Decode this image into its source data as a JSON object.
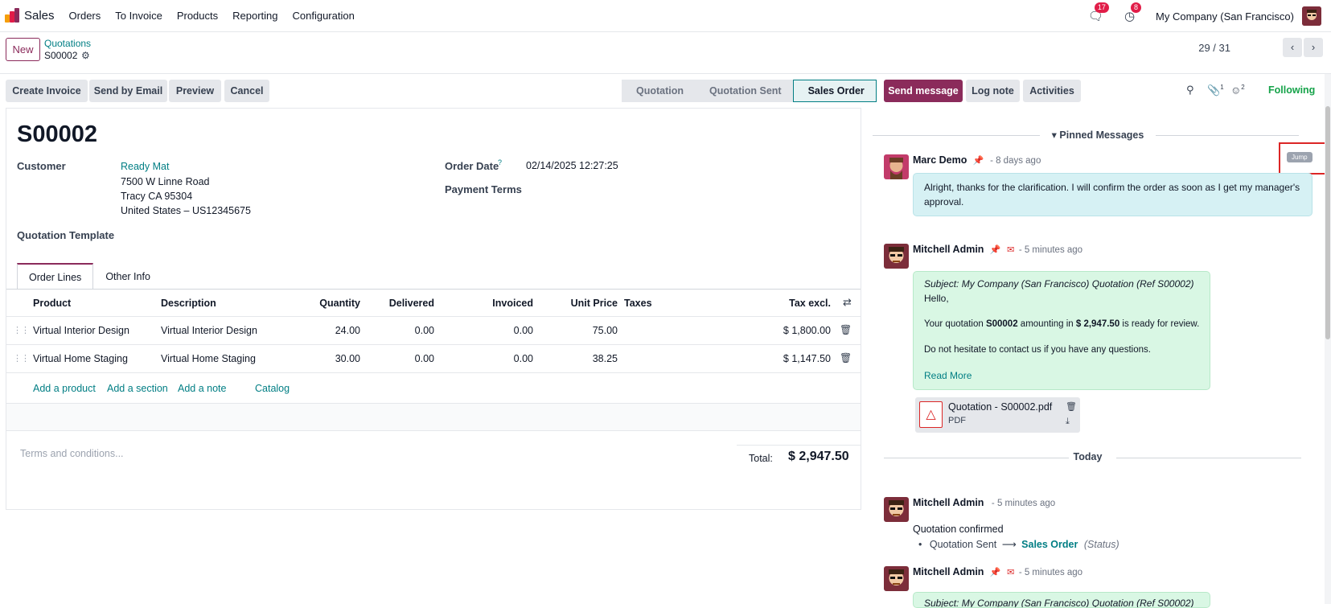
{
  "app": {
    "name": "Sales"
  },
  "menu": [
    "Orders",
    "To Invoice",
    "Products",
    "Reporting",
    "Configuration"
  ],
  "topbar": {
    "messages_badge": "17",
    "activities_badge": "8",
    "company": "My Company (San Francisco)"
  },
  "control": {
    "new_label": "New",
    "breadcrumb_parent": "Quotations",
    "breadcrumb_current": "S00002",
    "pager": "29 / 31"
  },
  "actions": {
    "create_invoice": "Create Invoice",
    "send_email": "Send by Email",
    "preview": "Preview",
    "cancel": "Cancel"
  },
  "status": [
    "Quotation",
    "Quotation Sent",
    "Sales Order"
  ],
  "form": {
    "title": "S00002",
    "customer_label": "Customer",
    "customer_name": "Ready Mat",
    "address1": "7500 W Linne Road",
    "address2": "Tracy CA 95304",
    "address3": "United States – US12345675",
    "order_date_label": "Order Date",
    "order_date_help": "?",
    "order_date": "02/14/2025 12:27:25",
    "payment_terms_label": "Payment Terms",
    "quotation_template_label": "Quotation Template"
  },
  "tabs": [
    "Order Lines",
    "Other Info"
  ],
  "table": {
    "headers": [
      "Product",
      "Description",
      "Quantity",
      "Delivered",
      "Invoiced",
      "Unit Price",
      "Taxes",
      "Tax excl."
    ],
    "rows": [
      [
        "Virtual Interior Design",
        "Virtual Interior Design",
        "24.00",
        "0.00",
        "0.00",
        "75.00",
        "",
        "$ 1,800.00"
      ],
      [
        "Virtual Home Staging",
        "Virtual Home Staging",
        "30.00",
        "0.00",
        "0.00",
        "38.25",
        "",
        "$ 1,147.50"
      ]
    ],
    "add_product": "Add a product",
    "add_section": "Add a section",
    "add_note": "Add a note",
    "catalog": "Catalog"
  },
  "footer": {
    "terms_placeholder": "Terms and conditions...",
    "total_label": "Total:",
    "total_value": "$ 2,947.50"
  },
  "chatter": {
    "send_message": "Send message",
    "log_note": "Log note",
    "activities": "Activities",
    "attachments_count": "1",
    "followers_count": "2",
    "following": "Following",
    "pinned_title": "Pinned Messages",
    "jump": "Jump",
    "today": "Today",
    "messages": [
      {
        "author": "Marc Demo",
        "time": "- 8 days ago",
        "body": "Alright, thanks for the clarification. I will confirm the order as soon as I get my manager's approval."
      },
      {
        "author": "Mitchell Admin",
        "time": "- 5 minutes ago",
        "subject": "Subject: My Company (San Francisco) Quotation (Ref S00002)",
        "greeting": "Hello,",
        "line1_a": "Your quotation ",
        "line1_b": "S00002",
        "line1_c": " amounting in ",
        "line1_d": "$ 2,947.50",
        "line1_e": " is ready for review.",
        "line2": "Do not hesitate to contact us if you have any questions.",
        "read_more": "Read More",
        "attachment_name": "Quotation - S00002.pdf",
        "attachment_type": "PDF"
      },
      {
        "author": "Mitchell Admin",
        "time": "- 5 minutes ago",
        "event": "Quotation confirmed",
        "from": "Quotation Sent",
        "to": "Sales Order",
        "field": "(Status)"
      },
      {
        "author": "Mitchell Admin",
        "time": "- 5 minutes ago",
        "subject": "Subject: My Company (San Francisco) Quotation (Ref S00002)"
      }
    ]
  },
  "colors": {
    "primary": "#8b2b5b",
    "link": "#017e84",
    "following": "#16a34a"
  }
}
